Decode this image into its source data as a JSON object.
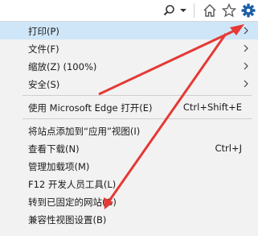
{
  "toolbar": {
    "search_icon": "search-icon",
    "dropdown_icon": "chevron-down-icon",
    "home_icon": "home-icon",
    "favorites_icon": "star-icon",
    "tools_icon": "gear-icon",
    "gear_color": "#1e5fa8"
  },
  "menu": {
    "items": [
      {
        "label": "打印(P)",
        "shortcut": "",
        "submenu": true,
        "highlighted": true
      },
      {
        "label": "文件(F)",
        "shortcut": "",
        "submenu": true
      },
      {
        "label": "缩放(Z) (100%)",
        "shortcut": "",
        "submenu": true
      },
      {
        "label": "安全(S)",
        "shortcut": "",
        "submenu": true
      },
      {
        "label": "使用 Microsoft Edge 打开(E)",
        "shortcut": "Ctrl+Shift+E",
        "submenu": false
      },
      {
        "label": "将站点添加到“应用”视图(I)",
        "shortcut": "",
        "submenu": false
      },
      {
        "label": "查看下载(N)",
        "shortcut": "Ctrl+J",
        "submenu": false
      },
      {
        "label": "管理加载项(M)",
        "shortcut": "",
        "submenu": false
      },
      {
        "label": "F12 开发人员工具(L)",
        "shortcut": "",
        "submenu": false
      },
      {
        "label": "转到已固定的网站(G)",
        "shortcut": "",
        "submenu": false
      },
      {
        "label": "兼容性视图设置(B)",
        "shortcut": "",
        "submenu": false
      }
    ],
    "highlight_color": "#cfe6f8"
  },
  "annotation": {
    "arrow_color": "#e53935"
  }
}
